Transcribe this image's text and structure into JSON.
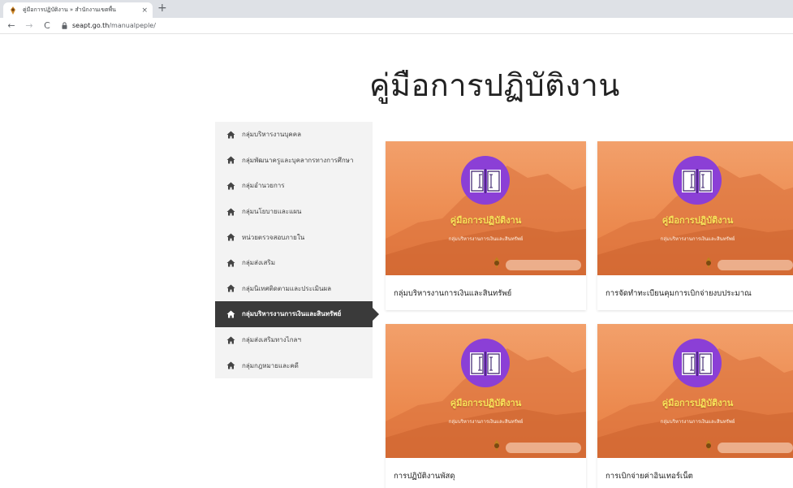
{
  "browser": {
    "tab_title": "คู่มือการปฏิบัติงาน » สำนักงานเขตพื้น",
    "new_tab_label": "+",
    "close_label": "×",
    "back_label": "←",
    "forward_label": "→",
    "reload_label": "C",
    "url_host": "seapt.go.th",
    "url_path": "/manualpeple/"
  },
  "page": {
    "title": "คู่มือการปฏิบัติงาน"
  },
  "sidebar": {
    "icon": "home-icon",
    "active_index": 7,
    "items": [
      {
        "label": "กลุ่มบริหารงานบุคคล"
      },
      {
        "label": "กลุ่มพัฒนาครูและบุคลากรทางการศึกษา"
      },
      {
        "label": "กลุ่มอำนวยการ"
      },
      {
        "label": "กลุ่มนโยบายและแผน"
      },
      {
        "label": "หน่วยตรวจสอบภายใน"
      },
      {
        "label": "กลุ่มส่งเสริม"
      },
      {
        "label": "กลุ่มนิเทศติดตามและประเมินผล"
      },
      {
        "label": "กลุ่มบริหารงานการเงินและสินทรัพย์"
      },
      {
        "label": "กลุ่มส่งเสริมทางไกลฯ"
      },
      {
        "label": "กลุ่มกฎหมายและคดี"
      }
    ]
  },
  "cards": [
    {
      "image_title": "คู่มือการปฏิบัติงาน",
      "image_subtitle": "กลุ่มบริหารงานการเงินและสินทรัพย์",
      "label": "กลุ่มบริหารงานการเงินและสินทรัพย์"
    },
    {
      "image_title": "คู่มือการปฏิบัติงาน",
      "image_subtitle": "กลุ่มบริหารงานการเงินและสินทรัพย์",
      "label": "การจัดทำทะเบียนคุมการเบิกจ่ายงบประมาณ"
    },
    {
      "image_title": "คู่มือการปฏิบัติงาน",
      "image_subtitle": "กลุ่มบริหารงานการเงินและสินทรัพย์",
      "label": "การปฏิบัติงานพัสดุ"
    },
    {
      "image_title": "คู่มือการปฏิบัติงาน",
      "image_subtitle": "กลุ่มบริหารงานการเงินและสินทรัพย์",
      "label": "การเบิกจ่ายค่าอินเทอร์เน็ต"
    }
  ],
  "colors": {
    "accent_dark": "#3a3a3a",
    "card_orange": "#ee9056",
    "book_purple": "#8b3fd6",
    "image_title_yellow": "#f7e25a"
  }
}
